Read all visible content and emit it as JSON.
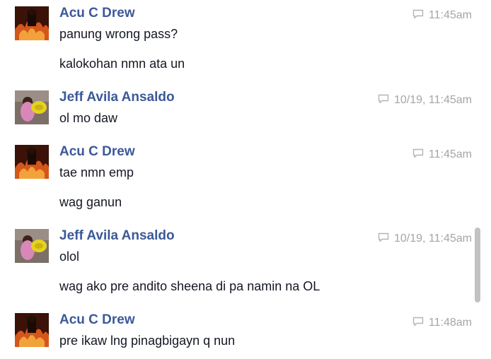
{
  "conversation": {
    "groups": [
      {
        "sender": "Acu C Drew",
        "avatar": "acu-avatar",
        "time": "11:45am",
        "messages": [
          "panung wrong pass?",
          "kalokohan nmn ata un"
        ]
      },
      {
        "sender": "Jeff Avila Ansaldo",
        "avatar": "jeff-avatar",
        "time": "10/19, 11:45am",
        "messages": [
          "ol mo daw"
        ]
      },
      {
        "sender": "Acu C Drew",
        "avatar": "acu-avatar",
        "time": "11:45am",
        "messages": [
          "tae nmn emp",
          "wag ganun"
        ]
      },
      {
        "sender": "Jeff Avila Ansaldo",
        "avatar": "jeff-avatar",
        "time": "10/19, 11:45am",
        "messages": [
          "olol",
          "wag ako pre andito sheena di pa namin na OL"
        ]
      },
      {
        "sender": "Acu C Drew",
        "avatar": "acu-avatar",
        "time": "11:48am",
        "messages": [
          "pre ikaw lng pinagbigayn q nun"
        ]
      }
    ]
  },
  "colors": {
    "sender": "#3b5998",
    "message": "#141823",
    "timestamp": "#a5a5a5",
    "scrollbar": "#c2c2c2"
  },
  "icons": {
    "timestamp": "chat-bubble-icon"
  }
}
